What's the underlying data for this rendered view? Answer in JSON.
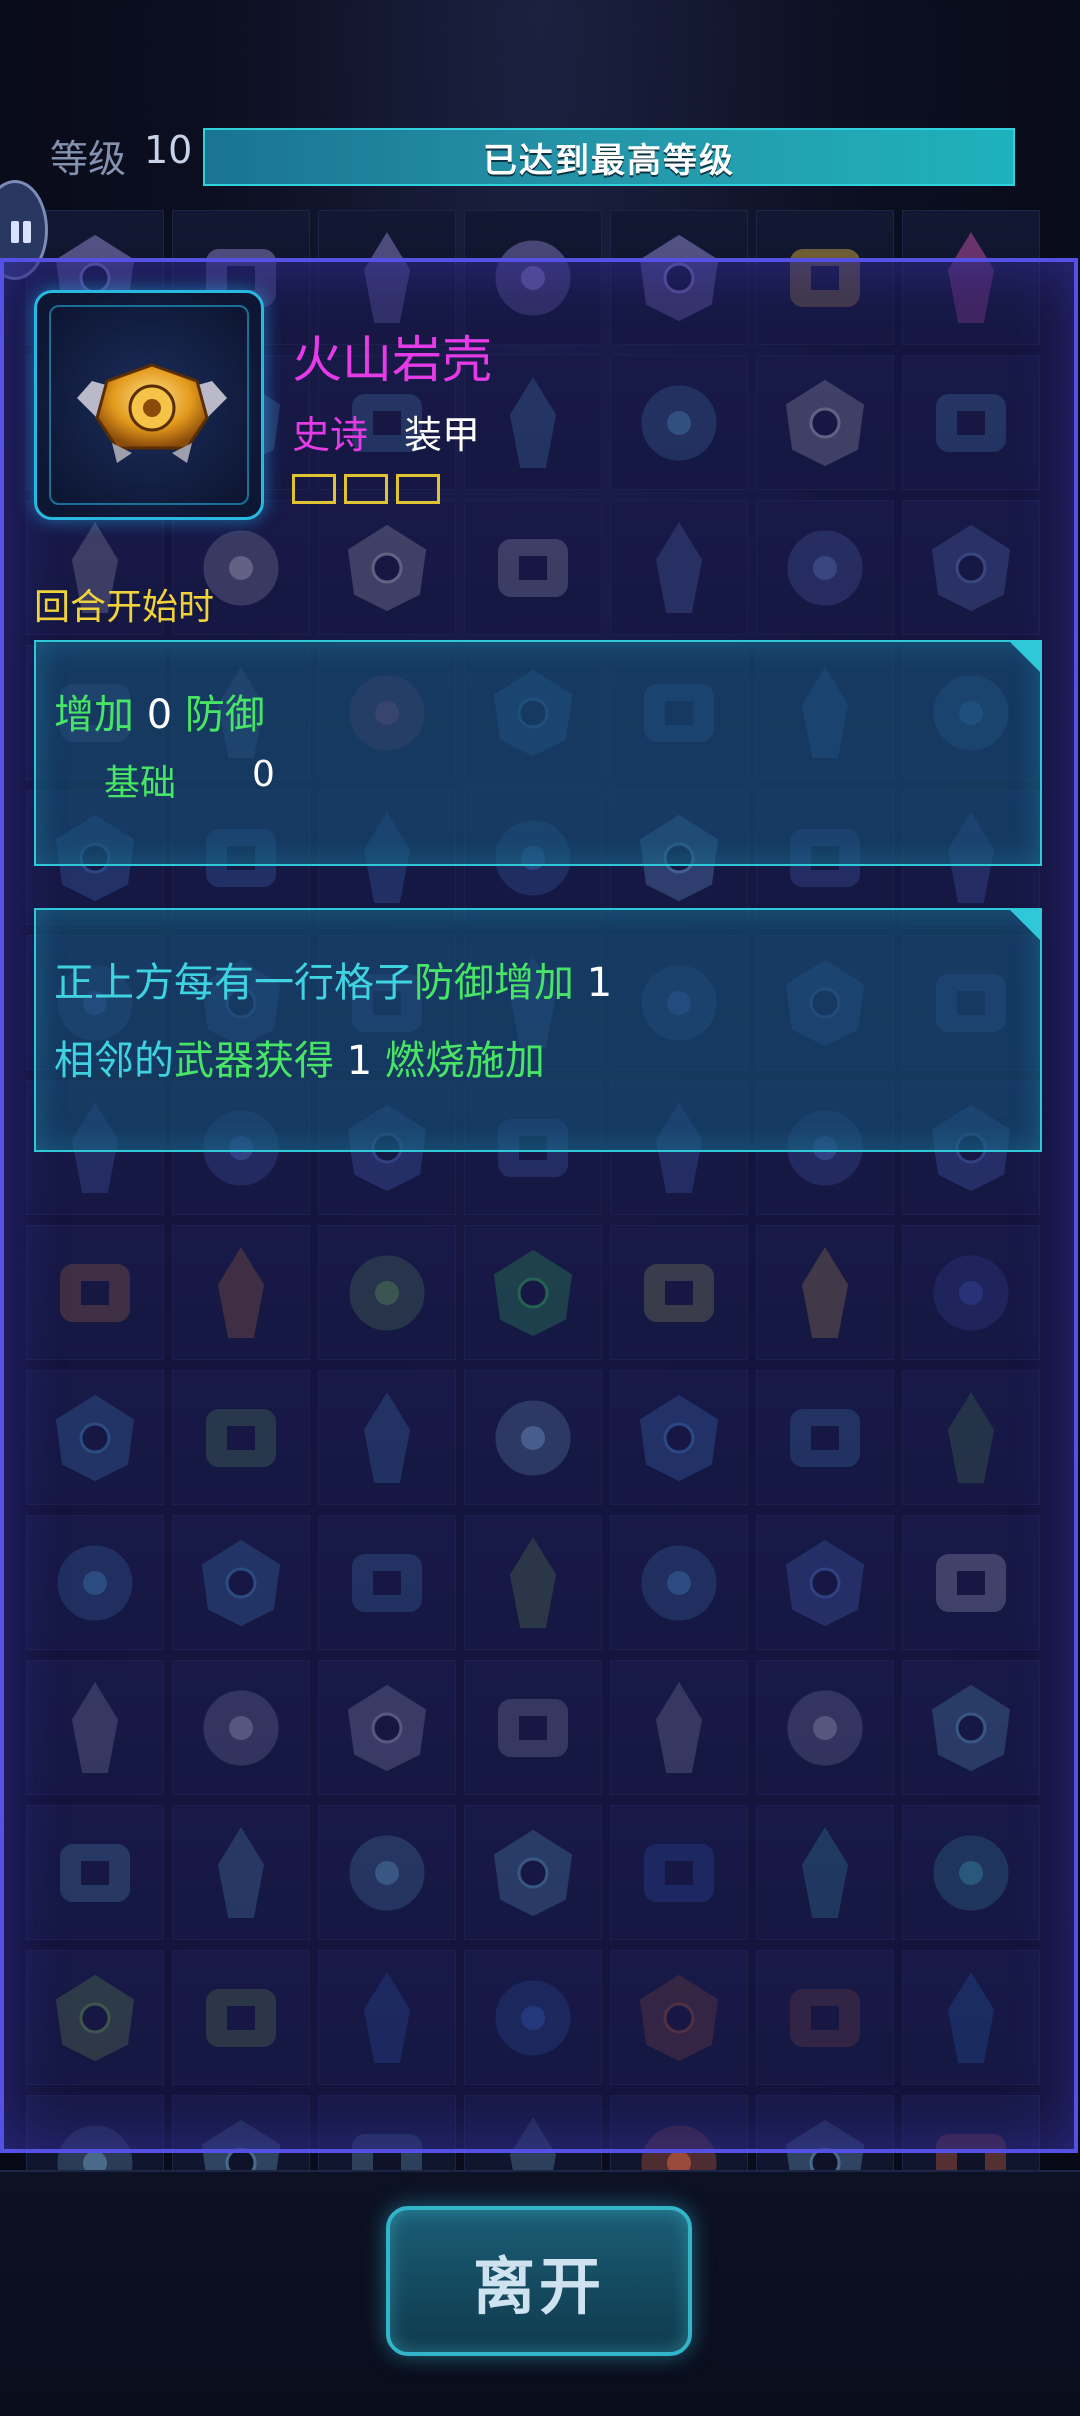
{
  "header": {
    "level_label": "等级",
    "level_value": "10",
    "level_bar_text": "已达到最高等级"
  },
  "item": {
    "name": "火山岩壳",
    "rarity": "史诗",
    "type": "装甲",
    "empty_slots": 3,
    "icon": "golden-armor-shell-icon"
  },
  "trigger": "回合开始时",
  "effect_panel_1": {
    "line_parts": [
      "增加",
      "0",
      "防御"
    ],
    "base_label": "基础",
    "base_value": "0"
  },
  "effect_panel_2": {
    "line1_parts": [
      "正上方每有一行格子",
      "防御增加",
      "1"
    ],
    "line2_parts": [
      "相邻的",
      "武器",
      "获得",
      "1",
      "燃烧施加"
    ]
  },
  "footer": {
    "leave_button": "离开"
  },
  "colors": {
    "modal_border": "#5451e4",
    "rarity_epic": "#e43be6",
    "effect_green": "#47e466",
    "effect_cyan": "#3fd2e0",
    "trigger_yellow": "#f0d23a",
    "panel_border": "#2ec8d8"
  },
  "grid_icons": [
    "ship-icon",
    "ship-icon",
    "ship-icon",
    "ship-icon",
    "ship-icon",
    "claw-icon",
    "tentacle-icon",
    "cannon-icon",
    "cannon-icon",
    "cannon-icon",
    "cannon-icon",
    "cannon-icon",
    "missile-icon",
    "cannon-icon",
    "missile-icon",
    "missile-icon",
    "missile-icon",
    "missile-icon",
    "engine-icon",
    "engine-icon",
    "engine-icon",
    "engine-icon",
    "engine-icon",
    "core-icon",
    "armor-icon",
    "armor-icon",
    "armor-icon",
    "armor-icon",
    "armor-icon",
    "armor-icon",
    "armor-icon",
    "armor-icon",
    "turret-icon",
    "wing-icon",
    "wing-icon",
    "wing-icon",
    "wing-icon",
    "wing-icon",
    "wing-icon",
    "wing-icon",
    "wing-icon",
    "wing-icon",
    "wing-icon",
    "wing-icon",
    "wing-icon",
    "wing-icon",
    "wing-icon",
    "wing-icon",
    "wing-icon",
    "shield-icon",
    "shield-icon",
    "gear-icon",
    "clover-icon",
    "reactor-icon",
    "claw-icon",
    "gem-shield-icon",
    "module-icon",
    "gear-icon",
    "module-icon",
    "blaster-icon",
    "armor-icon",
    "module-icon",
    "barrel-icon",
    "module-icon",
    "module-icon",
    "module-icon",
    "drone-icon",
    "module-icon",
    "wing-icon",
    "rock-icon",
    "crystal-icon",
    "crystal-icon",
    "crystal-icon",
    "crystal-icon",
    "crystal-icon",
    "crystal-icon",
    "thruster-icon",
    "thruster-icon",
    "thruster-icon",
    "thruster-icon",
    "thruster-icon",
    "portal-icon",
    "arm-icon",
    "arm-icon",
    "drone-icon",
    "drone-icon",
    "panel-icon",
    "panel-icon",
    "mine-icon",
    "mine-icon",
    "container-icon",
    "medkit-icon",
    "medkit-icon",
    "medkit-icon",
    "medkit-icon",
    "canister-icon",
    "medkit-icon",
    "canister-icon"
  ]
}
